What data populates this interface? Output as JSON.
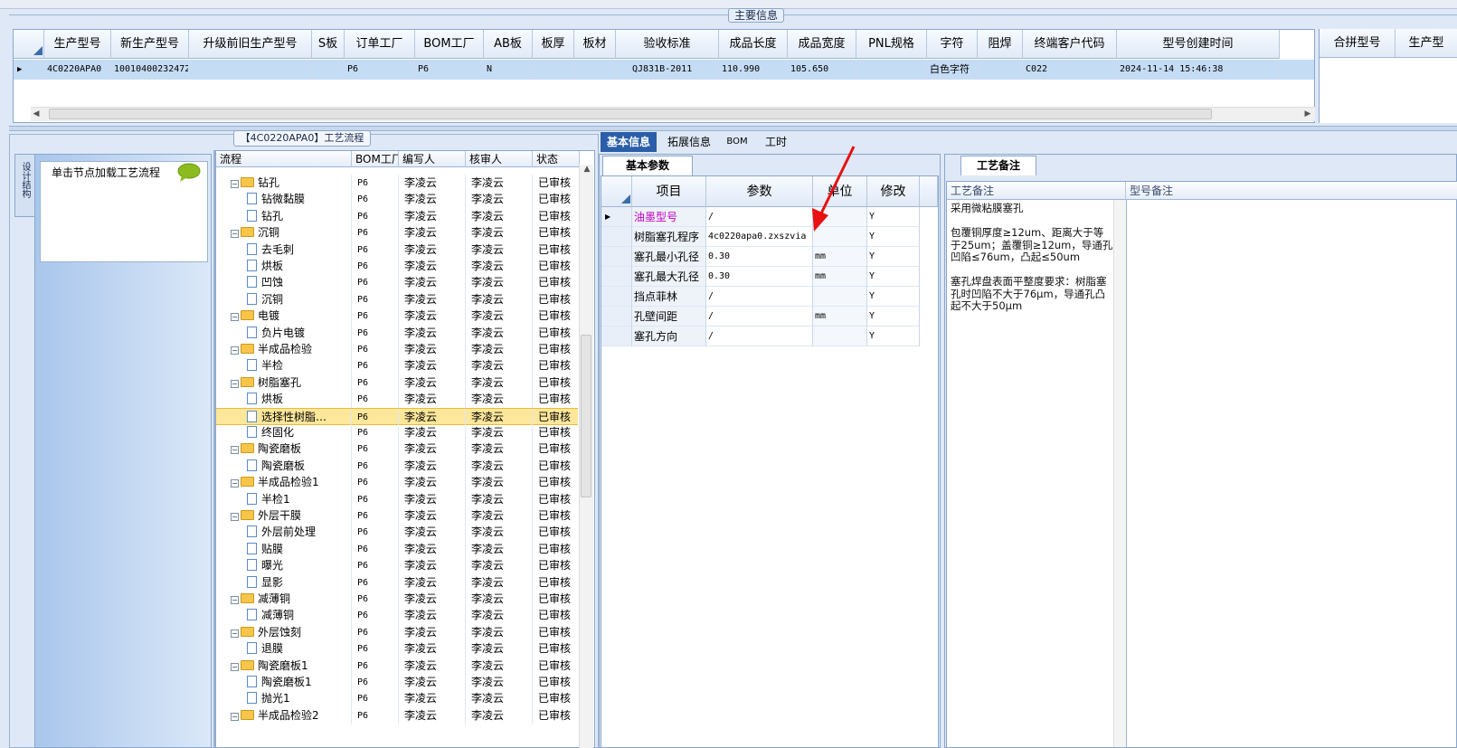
{
  "main_info": {
    "legend": "主要信息",
    "columns": [
      "生产型号",
      "新生产型号",
      "升级前旧生产型号",
      "S板",
      "订单工厂",
      "BOM工厂",
      "AB板",
      "板厚",
      "板材",
      "验收标准",
      "成品长度",
      "成品宽度",
      "PNL规格",
      "字符",
      "阻焊",
      "终端客户代码",
      "型号创建时间"
    ],
    "row": [
      "4C0220APA0",
      "10010400232472",
      "",
      "",
      "P6",
      "P6",
      "N",
      "",
      "",
      "QJ831B-2011",
      "110.990",
      "105.650",
      "",
      "白色字符",
      "",
      "C022",
      "2024-11-14 15:46:38"
    ],
    "right_columns": [
      "合拼型号",
      "生产型"
    ]
  },
  "flow_panel": {
    "legend": "【4C0220APA0】工艺流程",
    "side_tab_label": "设计结构",
    "hint": "单击节点加载工艺流程",
    "columns": [
      "流程",
      "BOM工厂",
      "编写人",
      "核审人",
      "状态"
    ],
    "rows": [
      {
        "indent": 1,
        "type": "folder",
        "name": "钻孔",
        "factory": "P6",
        "writer": "李凌云",
        "reviewer": "李凌云",
        "status": "已审核"
      },
      {
        "indent": 2,
        "type": "doc",
        "name": "钻微黏膜",
        "factory": "P6",
        "writer": "李凌云",
        "reviewer": "李凌云",
        "status": "已审核"
      },
      {
        "indent": 2,
        "type": "doc",
        "name": "钻孔",
        "factory": "P6",
        "writer": "李凌云",
        "reviewer": "李凌云",
        "status": "已审核"
      },
      {
        "indent": 1,
        "type": "folder",
        "name": "沉铜",
        "factory": "P6",
        "writer": "李凌云",
        "reviewer": "李凌云",
        "status": "已审核"
      },
      {
        "indent": 2,
        "type": "doc",
        "name": "去毛刺",
        "factory": "P6",
        "writer": "李凌云",
        "reviewer": "李凌云",
        "status": "已审核"
      },
      {
        "indent": 2,
        "type": "doc",
        "name": "烘板",
        "factory": "P6",
        "writer": "李凌云",
        "reviewer": "李凌云",
        "status": "已审核"
      },
      {
        "indent": 2,
        "type": "doc",
        "name": "凹蚀",
        "factory": "P6",
        "writer": "李凌云",
        "reviewer": "李凌云",
        "status": "已审核"
      },
      {
        "indent": 2,
        "type": "doc",
        "name": "沉铜",
        "factory": "P6",
        "writer": "李凌云",
        "reviewer": "李凌云",
        "status": "已审核"
      },
      {
        "indent": 1,
        "type": "folder",
        "name": "电镀",
        "factory": "P6",
        "writer": "李凌云",
        "reviewer": "李凌云",
        "status": "已审核"
      },
      {
        "indent": 2,
        "type": "doc",
        "name": "负片电镀",
        "factory": "P6",
        "writer": "李凌云",
        "reviewer": "李凌云",
        "status": "已审核"
      },
      {
        "indent": 1,
        "type": "folder",
        "name": "半成品检验",
        "factory": "P6",
        "writer": "李凌云",
        "reviewer": "李凌云",
        "status": "已审核"
      },
      {
        "indent": 2,
        "type": "doc",
        "name": "半检",
        "factory": "P6",
        "writer": "李凌云",
        "reviewer": "李凌云",
        "status": "已审核"
      },
      {
        "indent": 1,
        "type": "folder",
        "name": "树脂塞孔",
        "factory": "P6",
        "writer": "李凌云",
        "reviewer": "李凌云",
        "status": "已审核"
      },
      {
        "indent": 2,
        "type": "doc",
        "name": "烘板",
        "factory": "P6",
        "writer": "李凌云",
        "reviewer": "李凌云",
        "status": "已审核"
      },
      {
        "indent": 2,
        "type": "doc",
        "name": "选择性树脂…",
        "factory": "P6",
        "writer": "李凌云",
        "reviewer": "李凌云",
        "status": "已审核",
        "selected": true
      },
      {
        "indent": 2,
        "type": "doc",
        "name": "终固化",
        "factory": "P6",
        "writer": "李凌云",
        "reviewer": "李凌云",
        "status": "已审核"
      },
      {
        "indent": 1,
        "type": "folder",
        "name": "陶瓷磨板",
        "factory": "P6",
        "writer": "李凌云",
        "reviewer": "李凌云",
        "status": "已审核"
      },
      {
        "indent": 2,
        "type": "doc",
        "name": "陶瓷磨板",
        "factory": "P6",
        "writer": "李凌云",
        "reviewer": "李凌云",
        "status": "已审核"
      },
      {
        "indent": 1,
        "type": "folder",
        "name": "半成品检验1",
        "factory": "P6",
        "writer": "李凌云",
        "reviewer": "李凌云",
        "status": "已审核"
      },
      {
        "indent": 2,
        "type": "doc",
        "name": "半检1",
        "factory": "P6",
        "writer": "李凌云",
        "reviewer": "李凌云",
        "status": "已审核"
      },
      {
        "indent": 1,
        "type": "folder",
        "name": "外层干膜",
        "factory": "P6",
        "writer": "李凌云",
        "reviewer": "李凌云",
        "status": "已审核"
      },
      {
        "indent": 2,
        "type": "doc",
        "name": "外层前处理",
        "factory": "P6",
        "writer": "李凌云",
        "reviewer": "李凌云",
        "status": "已审核"
      },
      {
        "indent": 2,
        "type": "doc",
        "name": "贴膜",
        "factory": "P6",
        "writer": "李凌云",
        "reviewer": "李凌云",
        "status": "已审核"
      },
      {
        "indent": 2,
        "type": "doc",
        "name": "曝光",
        "factory": "P6",
        "writer": "李凌云",
        "reviewer": "李凌云",
        "status": "已审核"
      },
      {
        "indent": 2,
        "type": "doc",
        "name": "显影",
        "factory": "P6",
        "writer": "李凌云",
        "reviewer": "李凌云",
        "status": "已审核"
      },
      {
        "indent": 1,
        "type": "folder",
        "name": "减薄铜",
        "factory": "P6",
        "writer": "李凌云",
        "reviewer": "李凌云",
        "status": "已审核"
      },
      {
        "indent": 2,
        "type": "doc",
        "name": "减薄铜",
        "factory": "P6",
        "writer": "李凌云",
        "reviewer": "李凌云",
        "status": "已审核"
      },
      {
        "indent": 1,
        "type": "folder",
        "name": "外层蚀刻",
        "factory": "P6",
        "writer": "李凌云",
        "reviewer": "李凌云",
        "status": "已审核"
      },
      {
        "indent": 2,
        "type": "doc",
        "name": "退膜",
        "factory": "P6",
        "writer": "李凌云",
        "reviewer": "李凌云",
        "status": "已审核"
      },
      {
        "indent": 1,
        "type": "folder",
        "name": "陶瓷磨板1",
        "factory": "P6",
        "writer": "李凌云",
        "reviewer": "李凌云",
        "status": "已审核"
      },
      {
        "indent": 2,
        "type": "doc",
        "name": "陶瓷磨板1",
        "factory": "P6",
        "writer": "李凌云",
        "reviewer": "李凌云",
        "status": "已审核"
      },
      {
        "indent": 2,
        "type": "doc",
        "name": "抛光1",
        "factory": "P6",
        "writer": "李凌云",
        "reviewer": "李凌云",
        "status": "已审核"
      },
      {
        "indent": 1,
        "type": "folder",
        "name": "半成品检验2",
        "factory": "P6",
        "writer": "李凌云",
        "reviewer": "李凌云",
        "status": "已审核"
      }
    ]
  },
  "tabs": [
    "基本信息",
    "拓展信息",
    "BOM",
    "工时"
  ],
  "basic_params": {
    "title": "基本参数",
    "columns": [
      "项目",
      "参数",
      "单位",
      "修改"
    ],
    "rows": [
      {
        "item": "油墨型号",
        "param": "/",
        "unit": "",
        "edit": "Y",
        "highlight": true
      },
      {
        "item": "树脂塞孔程序",
        "param": "4c0220apa0.zxszvia",
        "unit": "",
        "edit": "Y"
      },
      {
        "item": "塞孔最小孔径",
        "param": "0.30",
        "unit": "mm",
        "edit": "Y"
      },
      {
        "item": "塞孔最大孔径",
        "param": "0.30",
        "unit": "mm",
        "edit": "Y"
      },
      {
        "item": "挡点菲林",
        "param": "/",
        "unit": "",
        "edit": "Y"
      },
      {
        "item": "孔壁间距",
        "param": "/",
        "unit": "mm",
        "edit": "Y"
      },
      {
        "item": "塞孔方向",
        "param": "/",
        "unit": "",
        "edit": "Y"
      }
    ]
  },
  "process_notes": {
    "title": "工艺备注",
    "col_process": "工艺备注",
    "col_model": "型号备注",
    "lines": [
      "采用微粘膜塞孔",
      "",
      "包覆铜厚度≥12um、距离大于等",
      "于25um；盖覆铜≥12um，导通孔",
      "凹陷≤76um，凸起≤50um",
      "",
      "塞孔焊盘表面平整度要求：树脂塞",
      "孔时凹陷不大于76μm，导通孔凸",
      "起不大于50μm"
    ]
  },
  "colors": {
    "selected_row": "#fde79a",
    "grid_select": "#c5dcf5",
    "highlight_text": "#c000c0",
    "arrow": "#e81010"
  }
}
